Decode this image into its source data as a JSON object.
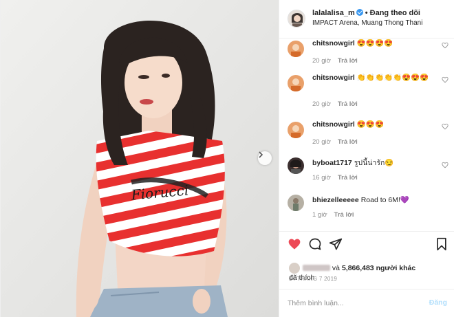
{
  "post": {
    "username": "lalalalisa_m",
    "separator": "•",
    "follow_status": "Đang theo dõi",
    "location": "IMPACT Arena, Muang Thong Thani",
    "photo_print_text": "Fiorucci"
  },
  "comments": [
    {
      "user": "chitsnowgirl",
      "text": "😍😍😍😍",
      "time": "20 giờ",
      "reply": "Trả lời"
    },
    {
      "user": "chitsnowgirl",
      "text": "👏👏👏👏👏😍😍😍",
      "time": "20 giờ",
      "reply": "Trả lời"
    },
    {
      "user": "chitsnowgirl",
      "text": "😍😍😍",
      "time": "20 giờ",
      "reply": "Trả lời"
    },
    {
      "user": "byboat1717",
      "text": "รูปนี้น่ารัก😏",
      "time": "16 giờ",
      "reply": "Trả lời"
    },
    {
      "user": "bhiezelleeeee",
      "text": "Road to 6M!💜",
      "time": "1 giờ",
      "reply": "Trả lời"
    }
  ],
  "likes": {
    "prefix": "và",
    "count": "5,866,483",
    "others_label": "người khác",
    "suffix": "đã thích"
  },
  "date": "14 THÁNG 7 2019",
  "add_comment": {
    "placeholder": "Thêm bình luận...",
    "post_label": "Đăng"
  },
  "icons": {
    "like": "heart-icon",
    "comment": "comment-icon",
    "share": "share-icon",
    "save": "bookmark-icon",
    "next": "chevron-right-icon",
    "verified": "verified-badge-icon"
  },
  "colors": {
    "liked_heart": "#ed4956",
    "verified": "#3897f0",
    "post_button_disabled": "#b2dffc",
    "stripe_red": "#e8302f"
  }
}
